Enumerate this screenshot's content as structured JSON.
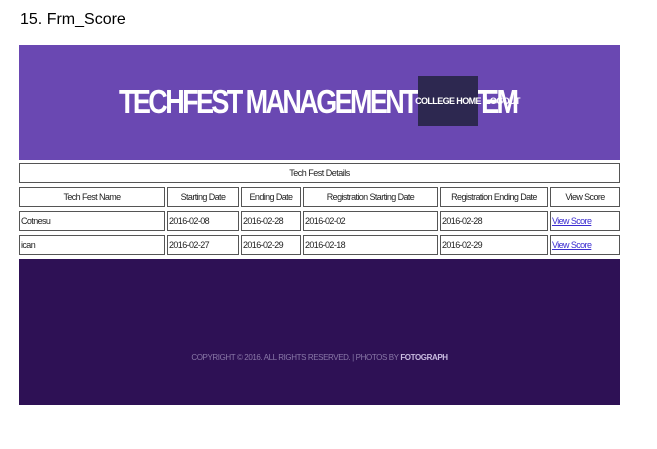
{
  "document": {
    "heading": "15. Frm_Score"
  },
  "header": {
    "title": "TECHFEST MANAGEMENT SYSTEM",
    "nav": {
      "home": "COLLEGE HOME",
      "logout": "LOGOUT"
    }
  },
  "table": {
    "caption": "Tech Fest Details",
    "columns": [
      "Tech Fest Name",
      "Starting Date",
      "Ending Date",
      "Registration Starting Date",
      "Registration Ending Date",
      "View Score"
    ],
    "rows": [
      [
        "Cotnesu",
        "2016-02-08",
        "2016-02-28",
        "2016-02-02",
        "2016-02-28",
        "View Score"
      ],
      [
        "ican",
        "2016-02-27",
        "2016-02-29",
        "2016-02-18",
        "2016-02-29",
        "View Score"
      ]
    ]
  },
  "footer": {
    "copyright": "COPYRIGHT © 2016. ALL RIGHTS RESERVED. | PHOTOS BY",
    "credit": "FOTOGRAPH"
  },
  "colors": {
    "banner": "#6a48b2",
    "nav_active": "#2d2850",
    "footer": "#2e1155",
    "link": "#3a2bd0"
  }
}
